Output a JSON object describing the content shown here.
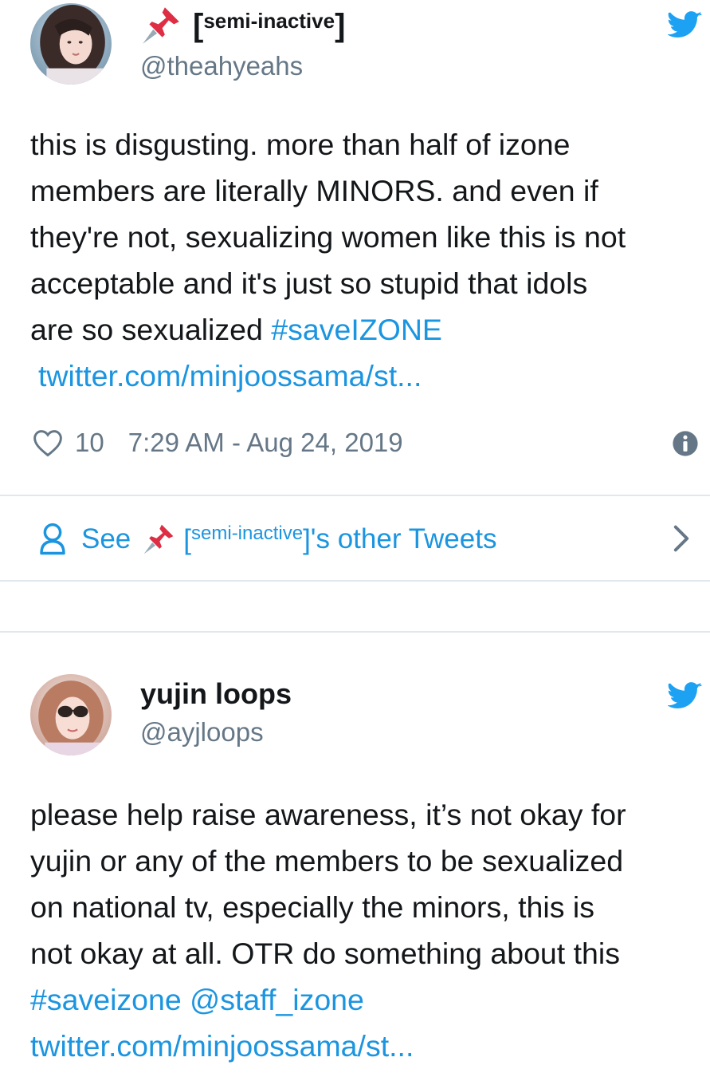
{
  "tweet1": {
    "display_name_small": "semi-inactive",
    "display_name_open": "[",
    "display_name_close": "]",
    "handle": "@theahyeahs",
    "body_lines": [
      "this is disgusting. more than half of izone",
      "members are literally MINORS. and even if",
      "they're not, sexualizing women like this is not",
      "acceptable and it's just so stupid that idols",
      "are so sexualized "
    ],
    "hashtag": "#saveIZONE",
    "link": "twitter.com/minjoossama/st...",
    "likes": "10",
    "timestamp": "7:29 AM - Aug 24, 2019",
    "see_other": {
      "prefix": "See",
      "name_open": "[",
      "name_small": "semi-inactive",
      "name_close": "]",
      "suffix": "'s other Tweets"
    }
  },
  "tweet2": {
    "display_name": "yujin loops",
    "handle": "@ayjloops",
    "body_lines": [
      "please help raise awareness, it’s not okay for",
      "yujin or any of the members to be sexualized",
      "on national tv, especially the minors, this is",
      "not okay at all. OTR do something about this"
    ],
    "hashtag": "#saveizone",
    "mention": "@staff_izone",
    "link": "twitter.com/minjoossama/st..."
  },
  "colors": {
    "twitter_blue": "#1da1f2",
    "link_blue": "#1b95e0",
    "secondary_text": "#657786",
    "divider": "#e1e8ed",
    "pin_red": "#dd2e44"
  },
  "icons": [
    "twitter-bird-icon",
    "pushpin-icon",
    "heart-icon",
    "info-icon",
    "person-icon",
    "chevron-right-icon"
  ]
}
